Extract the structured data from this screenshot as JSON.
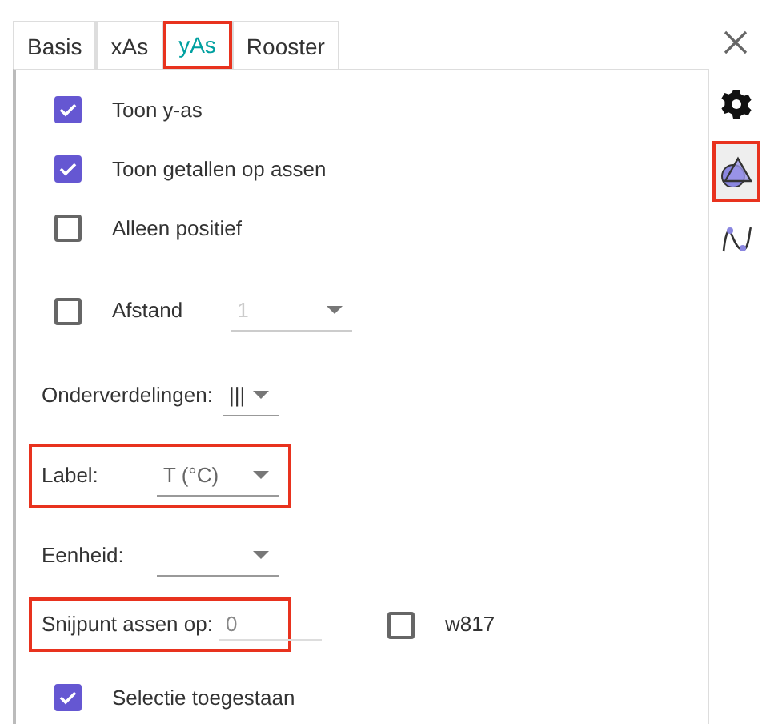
{
  "tabs": [
    {
      "label": "Basis",
      "selected": false,
      "highlighted": false
    },
    {
      "label": "xAs",
      "selected": false,
      "highlighted": false
    },
    {
      "label": "yAs",
      "selected": true,
      "highlighted": true
    },
    {
      "label": "Rooster",
      "selected": false,
      "highlighted": false
    }
  ],
  "side_icons": [
    {
      "kind": "gear",
      "selected": false,
      "highlighted": false
    },
    {
      "kind": "shapes",
      "selected": true,
      "highlighted": true
    },
    {
      "kind": "graph",
      "selected": false,
      "highlighted": false
    }
  ],
  "rows": [
    {
      "kind": "checkbox",
      "label": "Toon y-as",
      "checked": true
    },
    {
      "kind": "checkbox",
      "label": "Toon getallen op assen",
      "checked": true
    },
    {
      "kind": "checkbox",
      "label": "Alleen positief",
      "checked": false
    },
    {
      "kind": "checkbox-dropdown",
      "label": "Afstand",
      "checked": false,
      "dropdown": {
        "value": "1",
        "disabled": true
      }
    },
    {
      "kind": "dropdown",
      "label": "Onderverdelingen:",
      "value": "|||",
      "highlighted": false
    },
    {
      "kind": "dropdown",
      "label": "Label:",
      "value": "T (°C)",
      "highlighted": true
    },
    {
      "kind": "dropdown",
      "label": "Eenheid:",
      "highlighted": false
    },
    {
      "kind": "input",
      "label": "Snijpunt assen op:",
      "value": "0",
      "highlighted": true,
      "checkbox": {
        "label": "w817",
        "checked": false
      }
    },
    {
      "kind": "checkbox",
      "label": "Selectie toegestaan",
      "checked": true
    }
  ]
}
